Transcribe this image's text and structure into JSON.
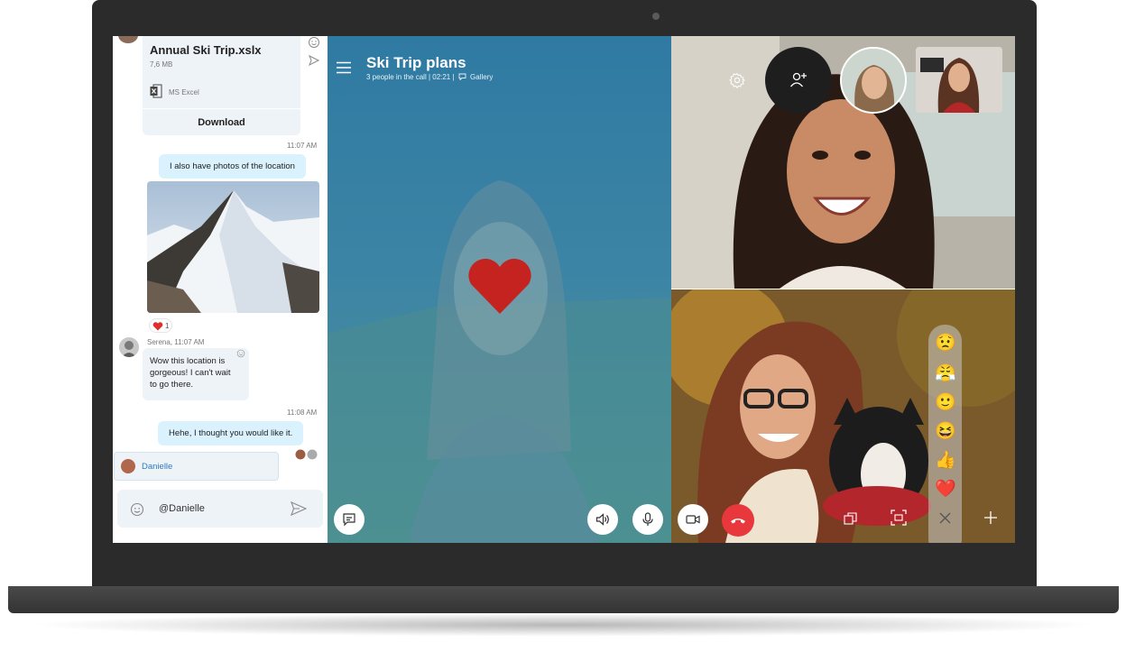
{
  "chat": {
    "file": {
      "name": "Annual Ski Trip.xslx",
      "size": "7,6 MB",
      "type": "MS Excel",
      "download_label": "Download"
    },
    "messages": [
      {
        "time": "11:07 AM",
        "text": "I also have photos of the location",
        "direction": "outgoing"
      },
      {
        "reaction_count": "1"
      },
      {
        "sender_time": "Serena, 11:07 AM",
        "text_lines": [
          "Wow this location is",
          "gorgeous! I can't wait",
          "to go there."
        ],
        "direction": "incoming"
      },
      {
        "time": "11:08 AM",
        "text": "Hehe, I thought you would like it.",
        "direction": "outgoing"
      }
    ],
    "mention_suggestion": "Danielle",
    "compose_value": "@Danielle"
  },
  "call": {
    "title": "Ski Trip plans",
    "subtitle": "3 people in the call | 02:21 |",
    "gallery_label": "Gallery"
  },
  "reactions_tray": [
    "😟",
    "😤",
    "🙂",
    "😆",
    "👍",
    "❤️"
  ],
  "colors": {
    "call_blue": "#2f7aa3",
    "end_call_red": "#e8383d",
    "bubble_out": "#daf2fd",
    "bubble_in": "#eef3f8",
    "heart_red": "#c4231f",
    "mention_blue": "#2b7bbf"
  },
  "icons": [
    "menu-icon",
    "emoji-icon",
    "send-icon",
    "excel-icon",
    "settings-icon",
    "add-people-icon",
    "chat-icon",
    "speaker-icon",
    "microphone-icon",
    "video-icon",
    "end-call-icon",
    "switch-camera-icon",
    "screen-share-icon",
    "close-icon",
    "plus-icon",
    "heart-icon"
  ]
}
